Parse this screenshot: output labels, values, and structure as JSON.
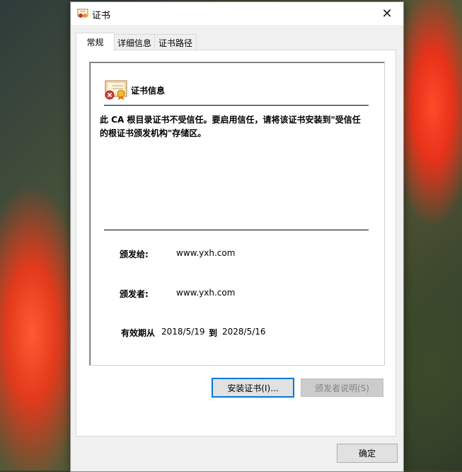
{
  "window": {
    "title": "证书",
    "close_glyph": "✕"
  },
  "tabs": [
    {
      "label": "常规",
      "active": true
    },
    {
      "label": "详细信息",
      "active": false
    },
    {
      "label": "证书路径",
      "active": false
    }
  ],
  "certificate": {
    "heading": "证书信息",
    "warning": "此 CA 根目录证书不受信任。要启用信任，请将该证书安装到\"受信任的根证书颁发机构\"存储区。",
    "issued_to_label": "颁发给:",
    "issued_to_value": "www.yxh.com",
    "issued_by_label": "颁发者:",
    "issued_by_value": "www.yxh.com",
    "validity_label": "有效期从",
    "valid_from": "2018/5/19",
    "validity_to_label": "到",
    "valid_to": "2028/5/16"
  },
  "buttons": {
    "install": "安装证书(I)...",
    "issuer_statement": "颁发者说明(S)",
    "ok": "确定"
  },
  "icons": {
    "title_icon": "certificate-icon",
    "cert_icon": "certificate-untrusted-icon",
    "close_icon": "close-icon"
  }
}
